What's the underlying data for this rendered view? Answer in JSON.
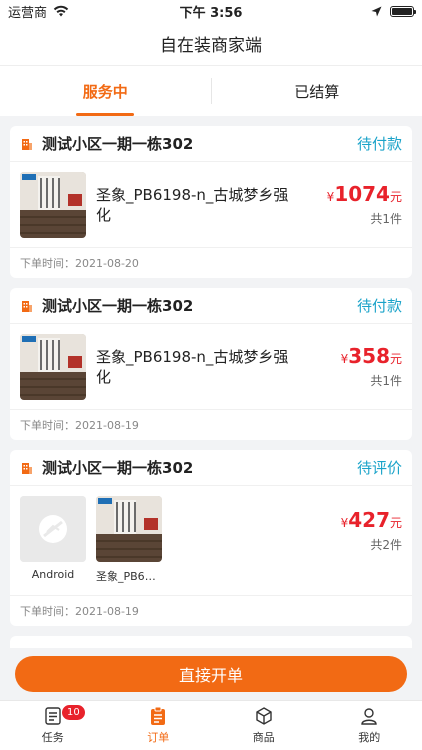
{
  "status_bar": {
    "carrier": "运营商",
    "time": "下午 3:56"
  },
  "nav": {
    "title": "自在装商家端"
  },
  "tabs": [
    {
      "label": "服务中",
      "active": true
    },
    {
      "label": "已结算",
      "active": false
    }
  ],
  "orders": [
    {
      "community": "测试小区一期一栋302",
      "status": "待付款",
      "product_name": "圣象_PB6198-n_古城梦乡强化",
      "price_symbol": "¥",
      "price": "1074",
      "price_unit": "元",
      "qty": "共1件",
      "date": "下单时间：2021-08-20"
    },
    {
      "community": "测试小区一期一栋302",
      "status": "待付款",
      "product_name": "圣象_PB6198-n_古城梦乡强化",
      "price_symbol": "¥",
      "price": "358",
      "price_unit": "元",
      "qty": "共1件",
      "date": "下单时间：2021-08-19"
    },
    {
      "community": "测试小区一期一栋302",
      "status": "待评价",
      "items": [
        "Android",
        "圣象_PB61..."
      ],
      "price_symbol": "¥",
      "price": "427",
      "price_unit": "元",
      "qty": "共2件",
      "date": "下单时间：2021-08-19"
    }
  ],
  "open_order_label": "直接开单",
  "tab_bar": {
    "items": [
      {
        "label": "任务",
        "icon": "task-icon",
        "badge": "10"
      },
      {
        "label": "订单",
        "icon": "order-icon",
        "active": true
      },
      {
        "label": "商品",
        "icon": "product-icon"
      },
      {
        "label": "我的",
        "icon": "profile-icon"
      }
    ]
  },
  "colors": {
    "accent": "#f26a14",
    "status": "#1aa3c9",
    "price": "#e8222b"
  }
}
